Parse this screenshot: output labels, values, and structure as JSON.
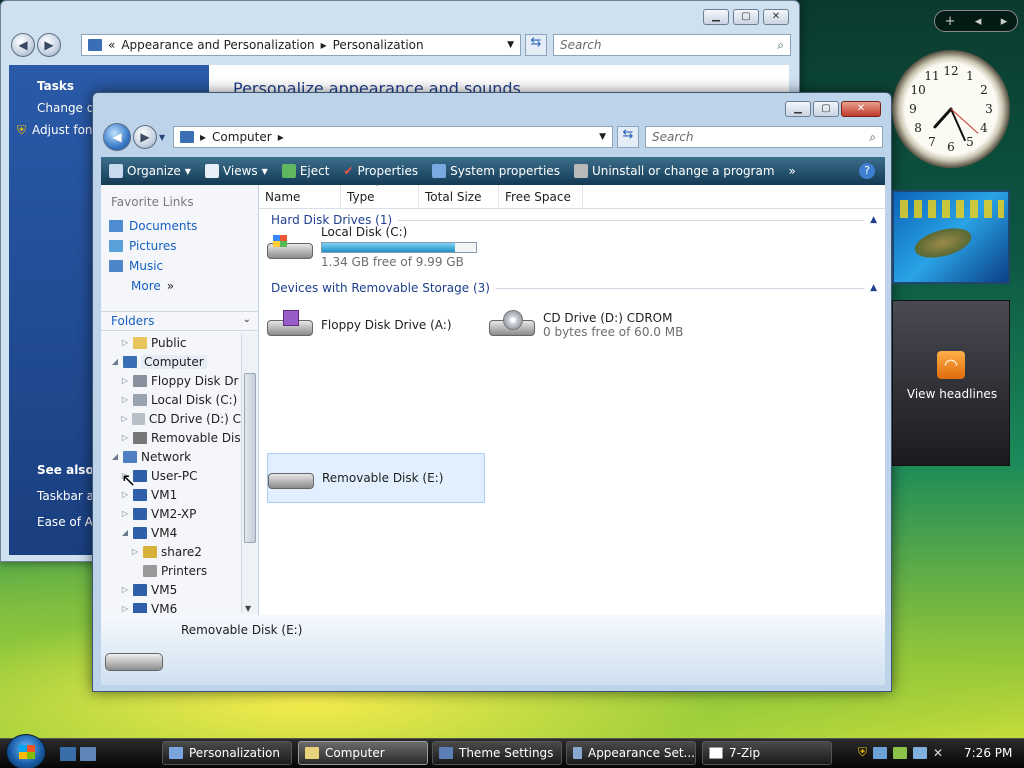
{
  "back_window": {
    "address": {
      "chevron": "«",
      "parts": [
        "Appearance and Personalization",
        "Personalization"
      ]
    },
    "search_placeholder": "Search",
    "sidebar": {
      "tasks_title": "Tasks",
      "items": [
        "Change de",
        "Adjust fon"
      ],
      "see_also_title": "See also",
      "see_also_items": [
        "Taskbar an",
        "Ease of Acc"
      ]
    },
    "main_heading": "Personalize appearance and sounds"
  },
  "front_window": {
    "address": {
      "parts": [
        "Computer"
      ]
    },
    "search_placeholder": "Search",
    "toolbar": [
      {
        "label": "Organize",
        "icon": "organize-icon",
        "dropdown": true
      },
      {
        "label": "Views",
        "icon": "views-icon",
        "dropdown": true
      },
      {
        "label": "Eject",
        "icon": "eject-icon"
      },
      {
        "label": "Properties",
        "icon": "properties-icon"
      },
      {
        "label": "System properties",
        "icon": "system-properties-icon"
      },
      {
        "label": "Uninstall or change a program",
        "icon": "uninstall-icon"
      }
    ],
    "toolbar_more": "»",
    "favorite_links_title": "Favorite Links",
    "favorite_links": [
      "Documents",
      "Pictures",
      "Music"
    ],
    "more_label": "More",
    "more_arrows": "»",
    "folders_title": "Folders",
    "tree": [
      {
        "label": "Public",
        "indent": 2,
        "icon": "folder-icon",
        "expander": "▷"
      },
      {
        "label": "Computer",
        "indent": 1,
        "icon": "computer-icon",
        "expander": "◢",
        "selected": true
      },
      {
        "label": "Floppy Disk Dr",
        "indent": 2,
        "icon": "floppy-icon",
        "expander": "▷"
      },
      {
        "label": "Local Disk (C:)",
        "indent": 2,
        "icon": "drive-icon",
        "expander": "▷"
      },
      {
        "label": "CD Drive (D:) C",
        "indent": 2,
        "icon": "cd-icon",
        "expander": "▷"
      },
      {
        "label": "Removable Dis",
        "indent": 2,
        "icon": "removable-icon",
        "expander": "▷"
      },
      {
        "label": "Network",
        "indent": 1,
        "icon": "network-icon",
        "expander": "◢"
      },
      {
        "label": "User-PC",
        "indent": 2,
        "icon": "pc-icon",
        "expander": "▷"
      },
      {
        "label": "VM1",
        "indent": 2,
        "icon": "pc-icon",
        "expander": "▷"
      },
      {
        "label": "VM2-XP",
        "indent": 2,
        "icon": "pc-icon",
        "expander": "▷"
      },
      {
        "label": "VM4",
        "indent": 2,
        "icon": "pc-icon",
        "expander": "◢"
      },
      {
        "label": "share2",
        "indent": 3,
        "icon": "share-icon",
        "expander": "▷"
      },
      {
        "label": "Printers",
        "indent": 3,
        "icon": "printer-icon",
        "expander": ""
      },
      {
        "label": "VM5",
        "indent": 2,
        "icon": "pc-icon",
        "expander": "▷"
      },
      {
        "label": "VM6",
        "indent": 2,
        "icon": "pc-icon",
        "expander": "▷"
      }
    ],
    "columns": [
      "Name",
      "Type",
      "Total Size",
      "Free Space"
    ],
    "group_hdd": "Hard Disk Drives (1)",
    "local_disk": {
      "name": "Local Disk (C:)",
      "free_text": "1.34 GB free of 9.99 GB",
      "used_fraction": 0.866
    },
    "group_removable": "Devices with Removable Storage (3)",
    "floppy": {
      "name": "Floppy Disk Drive (A:)"
    },
    "cdrom": {
      "name": "CD Drive (D:) CDROM",
      "free_text": "0 bytes free of 60.0 MB"
    },
    "removable": {
      "name": "Removable Disk (E:)"
    },
    "details_title": "Removable Disk (E:)"
  },
  "gadgets": {
    "feed_label": "View headlines",
    "clock_numbers": [
      "12",
      "1",
      "2",
      "3",
      "4",
      "5",
      "6",
      "7",
      "8",
      "9",
      "10",
      "11"
    ]
  },
  "taskbar": {
    "buttons": [
      {
        "label": "Personalization",
        "icon": "personalization-icon"
      },
      {
        "label": "Computer",
        "icon": "computer-icon",
        "active": true
      },
      {
        "label": "Theme Settings",
        "icon": "theme-icon"
      },
      {
        "label": "Appearance Set...",
        "icon": "appearance-icon"
      },
      {
        "label": "7-Zip",
        "icon": "7zip-icon"
      }
    ],
    "time": "7:26 PM"
  }
}
